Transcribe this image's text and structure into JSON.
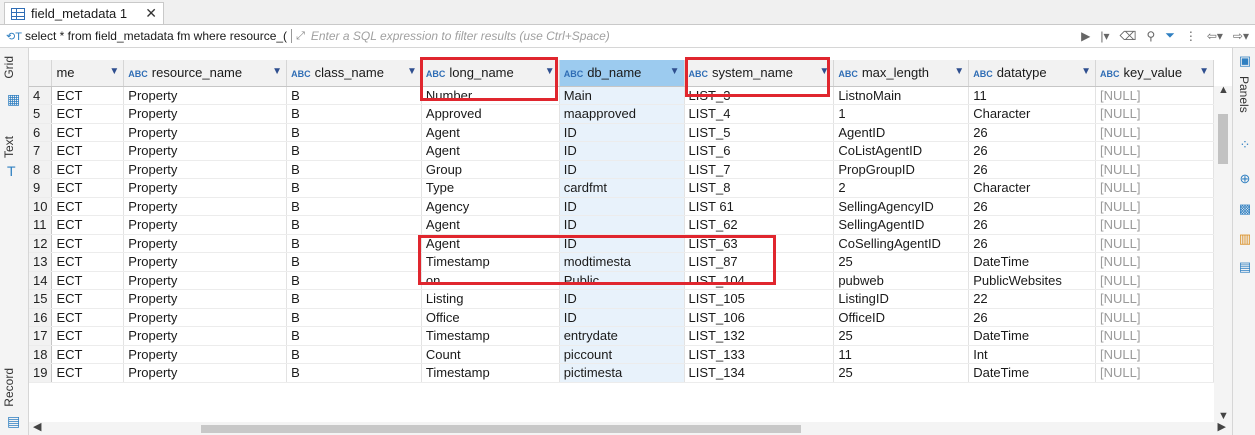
{
  "tab": {
    "label": "field_metadata 1",
    "close": "✕",
    "icon": "table-icon"
  },
  "filter": {
    "sql_icon": "sql-icon",
    "sql_text": "select * from field_metadata fm where resource_(",
    "hint": "Enter a SQL expression to filter results (use Ctrl+Space)"
  },
  "left_tabs": {
    "grid": "Grid",
    "text": "Text",
    "record": "Record"
  },
  "right_panel": {
    "label": "Panels"
  },
  "grid": {
    "columns": [
      {
        "label": "me",
        "abc": false,
        "dropdown": true
      },
      {
        "label": "resource_name",
        "abc": true,
        "dropdown": true
      },
      {
        "label": "class_name",
        "abc": true,
        "dropdown": true
      },
      {
        "label": "long_name",
        "abc": true,
        "dropdown": true
      },
      {
        "label": "db_name",
        "abc": true,
        "dropdown": true,
        "selected": true
      },
      {
        "label": "system_name",
        "abc": true,
        "dropdown": true
      },
      {
        "label": "max_length",
        "abc": true,
        "dropdown": true
      },
      {
        "label": "datatype",
        "abc": true,
        "dropdown": true
      },
      {
        "label": "key_value",
        "abc": true,
        "dropdown": true
      }
    ],
    "abc_label": "ABC",
    "rows": [
      [
        "4",
        "ECT",
        "Property",
        "B",
        "Number",
        "Main",
        "LIST_3",
        "ListnoMain",
        "11",
        "[NULL]"
      ],
      [
        "5",
        "ECT",
        "Property",
        "B",
        "Approved",
        "maapproved",
        "LIST_4",
        "1",
        "Character",
        "[NULL]"
      ],
      [
        "6",
        "ECT",
        "Property",
        "B",
        "Agent",
        "ID",
        "LIST_5",
        "AgentID",
        "26",
        "[NULL]"
      ],
      [
        "7",
        "ECT",
        "Property",
        "B",
        "Agent",
        "ID",
        "LIST_6",
        "CoListAgentID",
        "26",
        "[NULL]"
      ],
      [
        "8",
        "ECT",
        "Property",
        "B",
        "Group",
        "ID",
        "LIST_7",
        "PropGroupID",
        "26",
        "[NULL]"
      ],
      [
        "9",
        "ECT",
        "Property",
        "B",
        "Type",
        "cardfmt",
        "LIST_8",
        "2",
        "Character",
        "[NULL]"
      ],
      [
        "10",
        "ECT",
        "Property",
        "B",
        "Agency",
        "ID",
        "LIST 61",
        "SellingAgencyID",
        "26",
        "[NULL]"
      ],
      [
        "11",
        "ECT",
        "Property",
        "B",
        "Agent",
        "ID",
        "LIST_62",
        "SellingAgentID",
        "26",
        "[NULL]"
      ],
      [
        "12",
        "ECT",
        "Property",
        "B",
        "Agent",
        "ID",
        "LIST_63",
        "CoSellingAgentID",
        "26",
        "[NULL]"
      ],
      [
        "13",
        "ECT",
        "Property",
        "B",
        "Timestamp",
        "modtimesta",
        "LIST_87",
        "25",
        "DateTime",
        "[NULL]"
      ],
      [
        "14",
        "ECT",
        "Property",
        "B",
        "on",
        "Public",
        "LIST_104",
        "pubweb",
        "PublicWebsites",
        "[NULL]"
      ],
      [
        "15",
        "ECT",
        "Property",
        "B",
        "Listing",
        "ID",
        "LIST_105",
        "ListingID",
        "22",
        "[NULL]"
      ],
      [
        "16",
        "ECT",
        "Property",
        "B",
        "Office",
        "ID",
        "LIST_106",
        "OfficeID",
        "26",
        "[NULL]"
      ],
      [
        "17",
        "ECT",
        "Property",
        "B",
        "Timestamp",
        "entrydate",
        "LIST_132",
        "25",
        "DateTime",
        "[NULL]"
      ],
      [
        "18",
        "ECT",
        "Property",
        "B",
        "Count",
        "piccount",
        "LIST_133",
        "11",
        "Int",
        "[NULL]"
      ],
      [
        "19",
        "ECT",
        "Property",
        "B",
        "Timestamp",
        "pictimesta",
        "LIST_134",
        "25",
        "DateTime",
        "[NULL]"
      ]
    ]
  },
  "colors": {
    "annotation_red": "#e0262e",
    "selected_header": "#9ccbef",
    "accent": "#2f7fc1"
  }
}
